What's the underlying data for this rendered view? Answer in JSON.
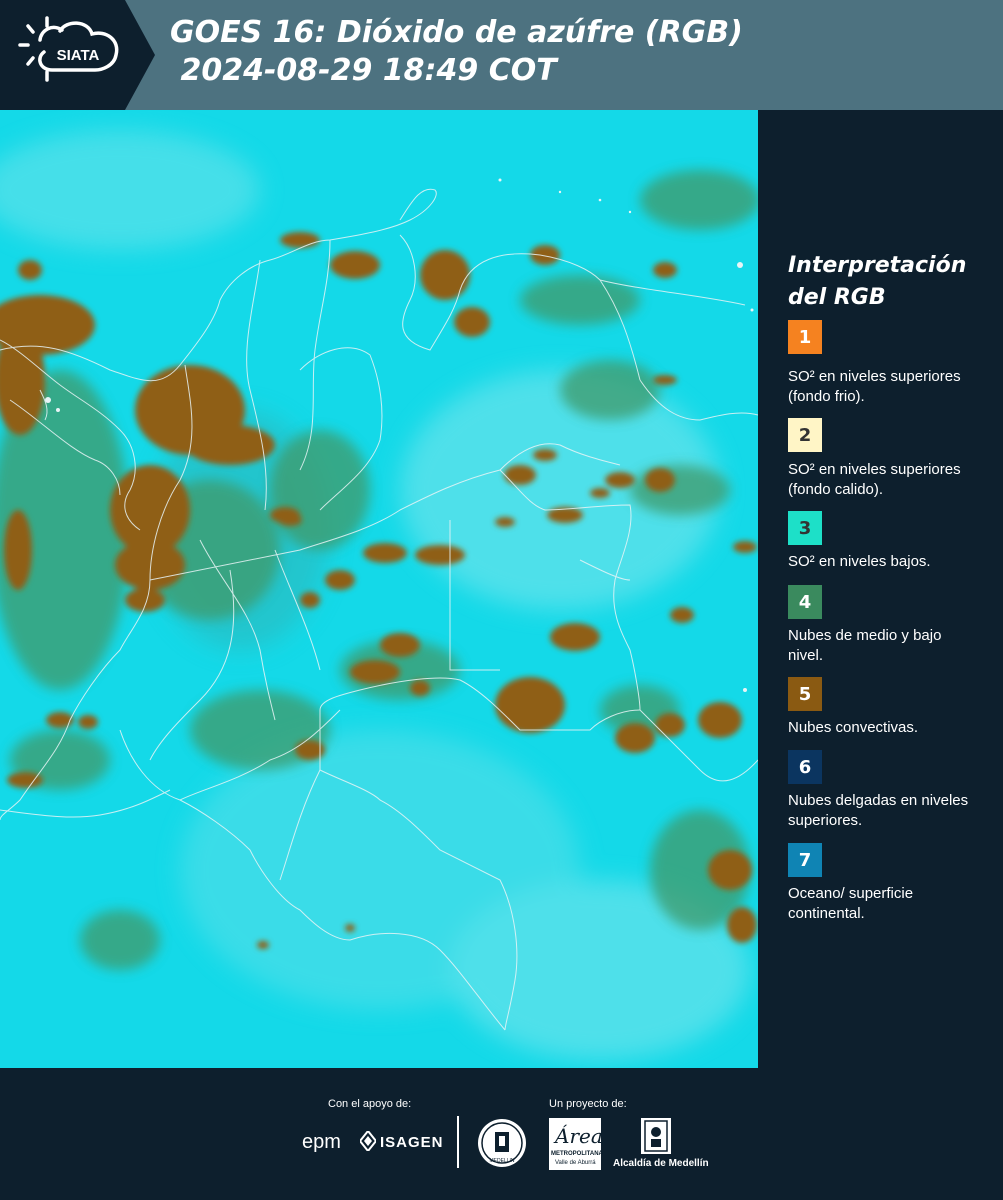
{
  "header": {
    "logo_text": "SIATA",
    "title_line1": "GOES 16: Dióxido de azúfre (RGB)",
    "title_line2": " 2024-08-29 18:49 COT",
    "background": "#4d7280"
  },
  "legend": {
    "title_line1": "Interpretación",
    "title_line2": "del RGB",
    "items": [
      {
        "num": "1",
        "color": "#f58220",
        "text_color": "#ffffff",
        "label": "SO² en niveles superiores (fondo frio)."
      },
      {
        "num": "2",
        "color": "#fff5c6",
        "text_color": "#333333",
        "label": "SO² en niveles superiores (fondo calido)."
      },
      {
        "num": "3",
        "color": "#1de0c8",
        "text_color": "#333333",
        "label": "SO² en niveles bajos."
      },
      {
        "num": "4",
        "color": "#3a8a5e",
        "text_color": "#ffffff",
        "label": "Nubes de medio y bajo nivel."
      },
      {
        "num": "5",
        "color": "#8a5a12",
        "text_color": "#ffffff",
        "label": "Nubes convectivas."
      },
      {
        "num": "6",
        "color": "#0b3560",
        "text_color": "#ffffff",
        "label": "Nubes delgadas en niveles superiores."
      },
      {
        "num": "7",
        "color": "#0f84b4",
        "text_color": "#ffffff",
        "label": "Oceano/ superficie continental."
      }
    ]
  },
  "footer": {
    "support_label": "Con el apoyo de:",
    "project_label": "Un proyecto de:",
    "epm": "epm",
    "isagen": "ISAGEN",
    "area_logo": "Área",
    "area_sub1": "METROPOLITANA",
    "area_sub2": "Valle de Aburrá",
    "alcaldia": "Alcaldía de Medellín",
    "medellin_seal": "MEDELLIN"
  },
  "map": {
    "ocean_color": "#12d8e8",
    "cloud_color": "#8a5a12",
    "lowcloud_color": "#3a8a5e"
  }
}
